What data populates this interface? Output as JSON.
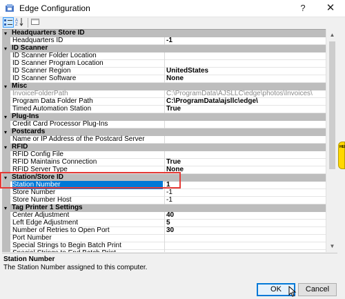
{
  "window": {
    "title": "Edge Configuration",
    "help": "?",
    "close": "✕"
  },
  "toolbar": {
    "categorized": "categorized-icon",
    "alphabetical": "az-sort-icon",
    "pages": "property-pages-icon"
  },
  "grid": {
    "rows": [
      {
        "kind": "cat",
        "label": "Headquarters Store ID"
      },
      {
        "kind": "prop",
        "name": "Headquarters ID",
        "value": "-1",
        "bold": true
      },
      {
        "kind": "cat",
        "label": "ID Scanner"
      },
      {
        "kind": "prop",
        "name": "ID Scanner Folder Location",
        "value": ""
      },
      {
        "kind": "prop",
        "name": "ID Scanner Program Location",
        "value": ""
      },
      {
        "kind": "prop",
        "name": "ID Scanner Region",
        "value": "UnitedStates",
        "bold": true
      },
      {
        "kind": "prop",
        "name": "ID Scanner Software",
        "value": "None",
        "bold": true
      },
      {
        "kind": "cat",
        "label": "Misc"
      },
      {
        "kind": "prop",
        "name": "InvoiceFolderPath",
        "value": "C:\\ProgramData\\AJSLLC\\edge\\photos\\Invoices\\",
        "grey": true
      },
      {
        "kind": "prop",
        "name": "Program Data Folder Path",
        "value": "C:\\ProgramData\\ajsllc\\edge\\",
        "bold": true
      },
      {
        "kind": "prop",
        "name": "Timed Automation Station",
        "value": "True",
        "bold": true
      },
      {
        "kind": "cat",
        "label": "Plug-Ins"
      },
      {
        "kind": "prop",
        "name": "Credit Card Processor Plug-Ins",
        "value": ""
      },
      {
        "kind": "cat",
        "label": "Postcards"
      },
      {
        "kind": "prop",
        "name": "Name or IP Address of the Postcard Server",
        "value": ""
      },
      {
        "kind": "cat",
        "label": "RFID"
      },
      {
        "kind": "prop",
        "name": "RFID Config File",
        "value": ""
      },
      {
        "kind": "prop",
        "name": "RFID Maintains Connection",
        "value": "True",
        "bold": true
      },
      {
        "kind": "prop",
        "name": "RFID Server Type",
        "value": "None",
        "bold": true
      },
      {
        "kind": "cat",
        "label": "Station/Store ID"
      },
      {
        "kind": "prop",
        "name": "Station Number",
        "value": "1",
        "bold": true,
        "selected": true
      },
      {
        "kind": "prop",
        "name": "Store Number",
        "value": "-1"
      },
      {
        "kind": "prop",
        "name": "Store Number Host",
        "value": "-1"
      },
      {
        "kind": "cat",
        "label": "Tag Printer 1 Settings"
      },
      {
        "kind": "prop",
        "name": "Center Adjustment",
        "value": "40",
        "bold": true
      },
      {
        "kind": "prop",
        "name": "Left Edge Adjustment",
        "value": "5",
        "bold": true
      },
      {
        "kind": "prop",
        "name": "Number of Retries to Open Port",
        "value": "30",
        "bold": true
      },
      {
        "kind": "prop",
        "name": "Port Number",
        "value": ""
      },
      {
        "kind": "prop",
        "name": "Special Strings to Begin Batch Print",
        "value": ""
      },
      {
        "kind": "prop",
        "name": "Special Strings to End Batch Print",
        "value": ""
      }
    ]
  },
  "helptab": {
    "label": "HELP"
  },
  "description": {
    "title": "Station Number",
    "text": "The Station Number assigned to this computer."
  },
  "buttons": {
    "ok": "OK",
    "cancel": "Cancel"
  },
  "colors": {
    "selection": "#0078d7",
    "category": "#bdbdbd",
    "highlight_box": "#e53935",
    "help_tab": "#ffd800"
  }
}
